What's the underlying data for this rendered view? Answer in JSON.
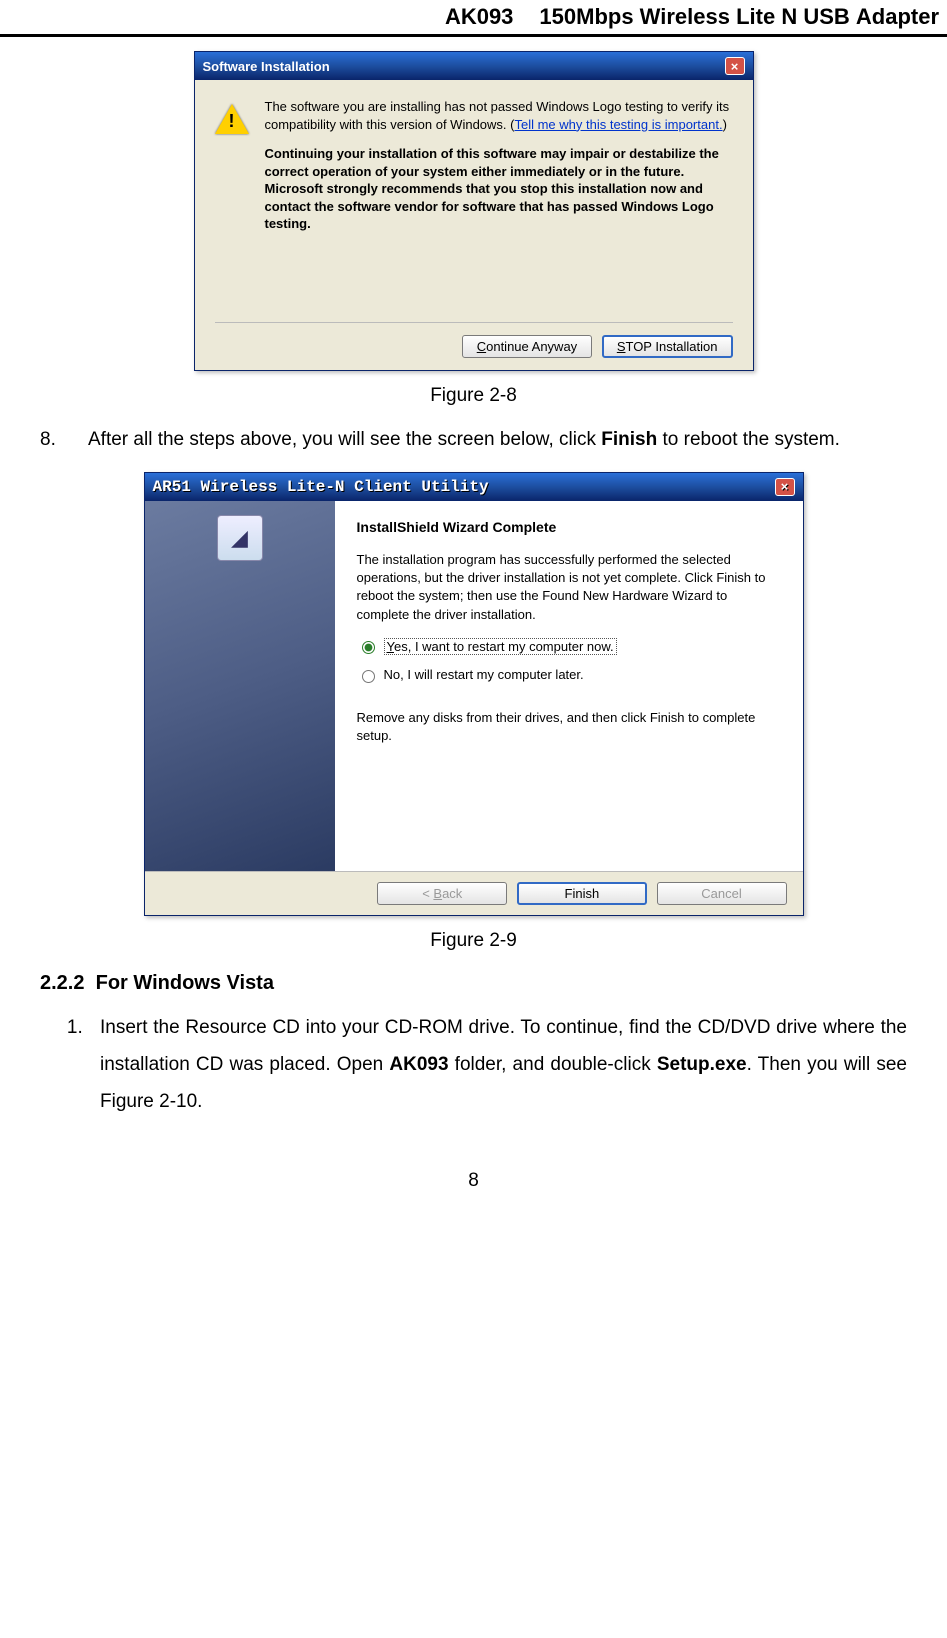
{
  "header": {
    "model": "AK093",
    "title": "150Mbps Wireless Lite N USB Adapter"
  },
  "dialog1": {
    "title": "Software Installation",
    "close": "×",
    "para1a": "The software you are installing has not passed Windows Logo testing to verify its compatibility with this version of Windows. (",
    "link": "Tell me why this testing is important.",
    "para1b": ")",
    "para2": "Continuing your installation of this software may impair or destabilize the correct operation of your system either immediately or in the future. Microsoft strongly recommends that you stop this installation now and contact the software vendor for software that has passed Windows Logo testing.",
    "btn_continue": "Continue Anyway",
    "btn_stop": "STOP Installation"
  },
  "fig1_caption": "Figure 2-8",
  "step8_num": "8.",
  "step8_a": "After all the steps above, you will see the screen below, click ",
  "step8_bold": "Finish",
  "step8_b": " to reboot the system.",
  "dialog2": {
    "title": "AR51 Wireless Lite-N Client Utility",
    "close": "×",
    "heading": "InstallShield Wizard Complete",
    "para1": "The installation program has successfully performed the selected operations, but the driver installation is not yet complete. Click Finish to reboot the system; then use the Found New Hardware Wizard to complete the driver installation.",
    "radio_yes": "Yes, I want to restart my computer now.",
    "radio_no": "No, I will restart my computer later.",
    "para2": "Remove any disks from their drives, and then click Finish to complete setup.",
    "btn_back": "< Back",
    "btn_finish": "Finish",
    "btn_cancel": "Cancel"
  },
  "fig2_caption": "Figure 2-9",
  "section_num": "2.2.2",
  "section_title": "For Windows Vista",
  "step1_a": "Insert the Resource CD into your CD-ROM drive. To continue, find the CD/DVD drive where the installation CD was placed. Open ",
  "step1_bold1": "AK093",
  "step1_b": " folder, and double-click ",
  "step1_bold2": "Setup.exe",
  "step1_c": ". Then you will see Figure 2-10.",
  "page_number": "8"
}
